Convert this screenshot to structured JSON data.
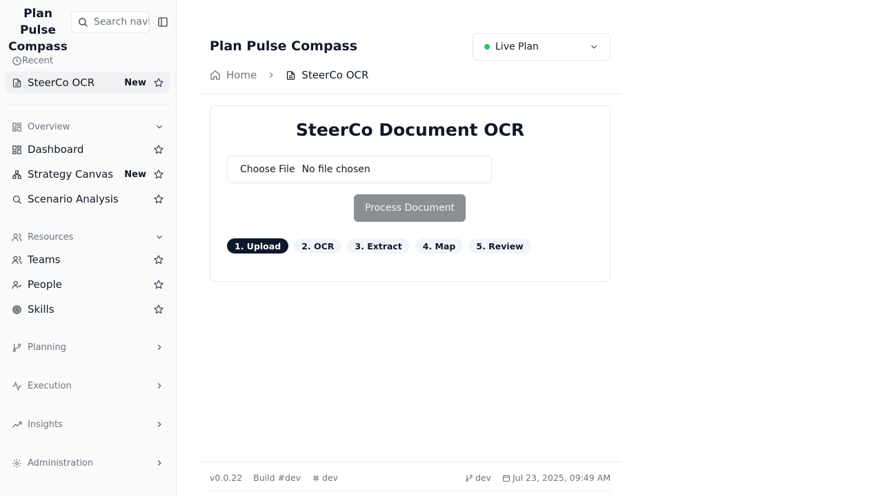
{
  "app": {
    "title": "Plan Pulse Compass"
  },
  "search": {
    "placeholder": "Search navigation"
  },
  "sidebar": {
    "recent_label": "Recent",
    "recent_item": {
      "label": "SteerCo OCR",
      "badge": "New"
    },
    "groups": {
      "overview": "Overview",
      "resources": "Resources",
      "planning": "Planning",
      "execution": "Execution",
      "insights": "Insights",
      "administration": "Administration"
    },
    "overview_items": [
      {
        "label": "Dashboard",
        "icon": "dashboard-icon"
      },
      {
        "label": "Strategy Canvas",
        "icon": "strategy-canvas-icon",
        "badge": "New"
      },
      {
        "label": "Scenario Analysis",
        "icon": "search-icon"
      }
    ],
    "resource_items": [
      {
        "label": "Teams",
        "icon": "users-icon"
      },
      {
        "label": "People",
        "icon": "user-check-icon"
      },
      {
        "label": "Skills",
        "icon": "target-icon"
      }
    ]
  },
  "header": {
    "title": "Plan Pulse Compass",
    "plan_select": {
      "value": "Live Plan",
      "status_color": "#22c55e"
    },
    "breadcrumb": {
      "home": "Home",
      "current": "SteerCo OCR"
    }
  },
  "card": {
    "title": "SteerCo Document OCR",
    "file_button": "Choose File",
    "file_status": "No file chosen",
    "process_button": "Process Document",
    "steps": [
      "1. Upload",
      "2. OCR",
      "3. Extract",
      "4. Map",
      "5. Review"
    ],
    "active_step": 0
  },
  "footer": {
    "version": "v0.0.22",
    "build": "Build #dev",
    "hash": "dev",
    "branch": "dev",
    "date": "Jul 23, 2025, 09:49 AM"
  }
}
